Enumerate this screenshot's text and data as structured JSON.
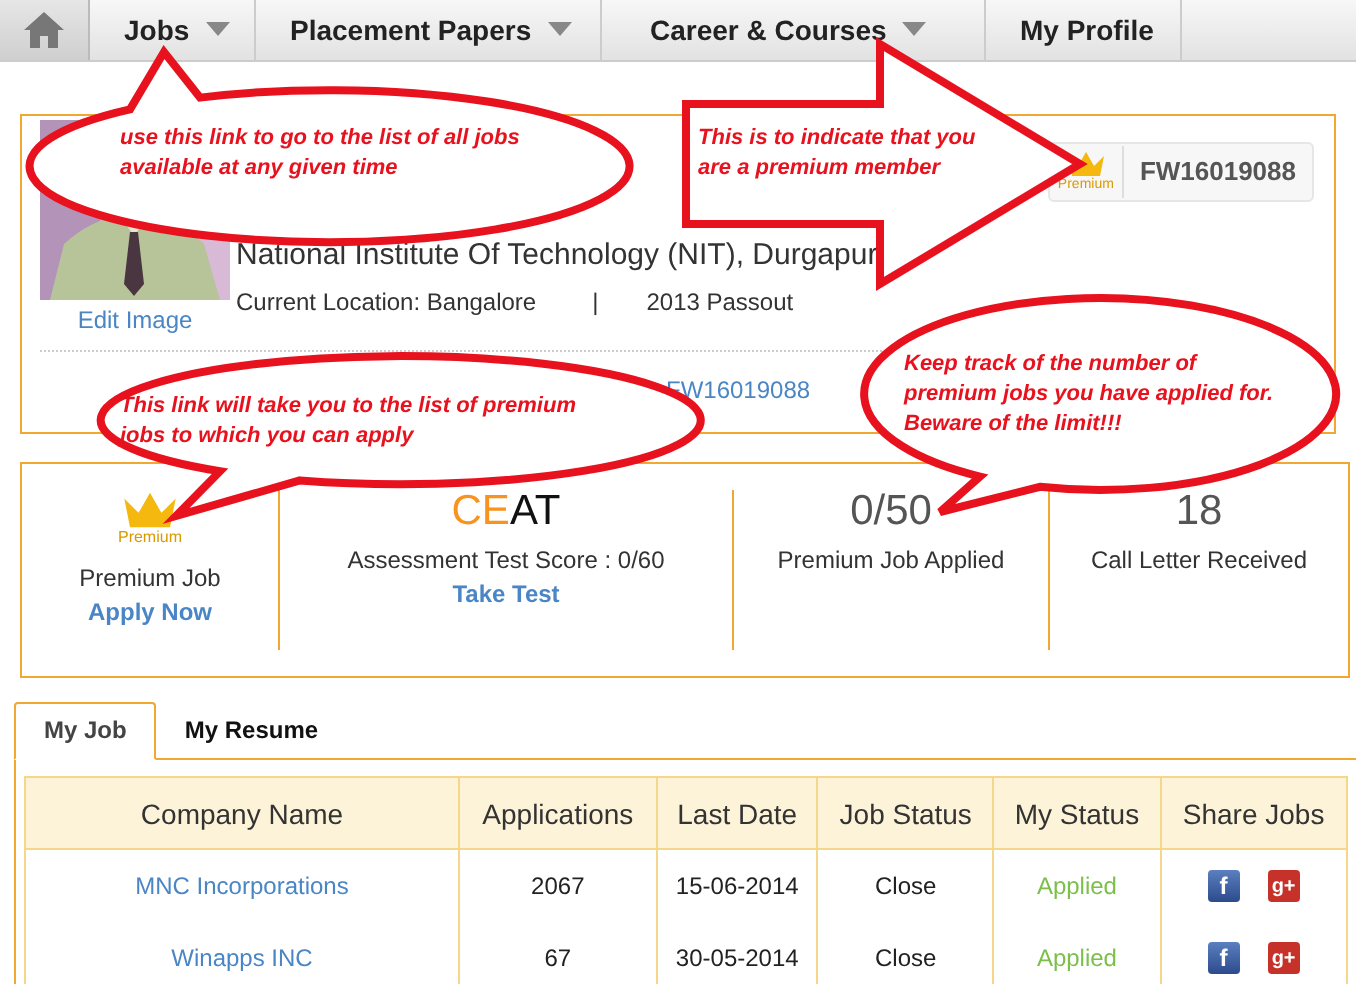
{
  "nav": {
    "items": [
      {
        "label": "Jobs",
        "dropdown": true
      },
      {
        "label": "Placement Papers",
        "dropdown": true
      },
      {
        "label": "Career & Courses",
        "dropdown": true
      },
      {
        "label": "My Profile",
        "dropdown": false
      }
    ]
  },
  "profile": {
    "edit_link": "Edit Image",
    "college": "National Institute Of Technology (NIT), Durgapur",
    "location": "Current Location: Bangalore",
    "separator": "|",
    "batch": "2013 Passout",
    "premium_badge": {
      "label": "Premium",
      "member_id": "FW16019088"
    },
    "profile_link": "FW16019088"
  },
  "stats": [
    {
      "kind": "premium",
      "badge": "Premium",
      "label": "Premium Job",
      "link": "Apply Now"
    },
    {
      "kind": "test",
      "logo": [
        {
          "text": "CE",
          "color": "#f7931e"
        },
        {
          "text": "AT",
          "color": "#111111"
        }
      ],
      "label": "Assessment Test Score : 0/60",
      "link": "Take Test"
    },
    {
      "kind": "count",
      "value": "0/50",
      "label": "Premium Job Applied"
    },
    {
      "kind": "count",
      "value": "18",
      "label": "Call Letter Received"
    }
  ],
  "tabs": [
    {
      "label": "My Job",
      "selected": true
    },
    {
      "label": "My Resume",
      "selected": false
    }
  ],
  "table": {
    "columns": [
      "Company Name",
      "Applications",
      "Last Date",
      "Job Status",
      "My Status",
      "Share Jobs"
    ],
    "rows": [
      {
        "company": "MNC Incorporations",
        "applications": "2067",
        "last_date": "15-06-2014",
        "job_status": "Close",
        "my_status": "Applied",
        "share": [
          {
            "kind": "facebook",
            "glyph": "f"
          },
          {
            "kind": "google",
            "glyph": "g+"
          }
        ]
      },
      {
        "company": "Winapps INC",
        "applications": "67",
        "last_date": "30-05-2014",
        "job_status": "Close",
        "my_status": "Applied",
        "share": [
          {
            "kind": "facebook",
            "glyph": "f"
          },
          {
            "kind": "google",
            "glyph": "g+"
          }
        ]
      }
    ]
  },
  "annotations": [
    {
      "kind": "bubble",
      "text": "use this link to go to the list of all jobs available at any given time"
    },
    {
      "kind": "arrow",
      "text": "This is to indicate that you are  a premium member"
    },
    {
      "kind": "bubble",
      "text": "This link will take you to the list of premium jobs to which you can  apply"
    },
    {
      "kind": "bubble",
      "text": "Keep track of the number of premium jobs you have applied for. Beware of the limit!!!"
    }
  ]
}
